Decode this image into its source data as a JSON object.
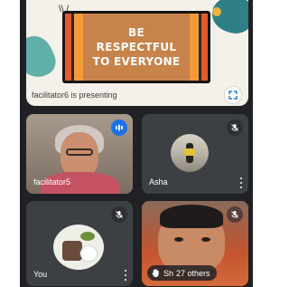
{
  "presentation": {
    "slide_lines": [
      "BE",
      "RESPECTFUL",
      "TO EVERYONE"
    ],
    "presenter_label": "facilitator6 is presenting"
  },
  "participants": [
    {
      "name": "facilitator5",
      "state": "speaking"
    },
    {
      "name": "Asha",
      "state": "muted"
    },
    {
      "name": "You",
      "state": "muted"
    },
    {
      "name": "Sh",
      "state": "muted"
    }
  ],
  "overflow": {
    "label": "27 others"
  },
  "colors": {
    "speaking": "#1a73e8",
    "tile_bg": "#3c4043",
    "screen_bg": "#202124"
  },
  "icons": [
    "fullscreen-icon",
    "audio-level-icon",
    "mic-off-icon",
    "more-vert-icon",
    "raise-hand-icon"
  ]
}
